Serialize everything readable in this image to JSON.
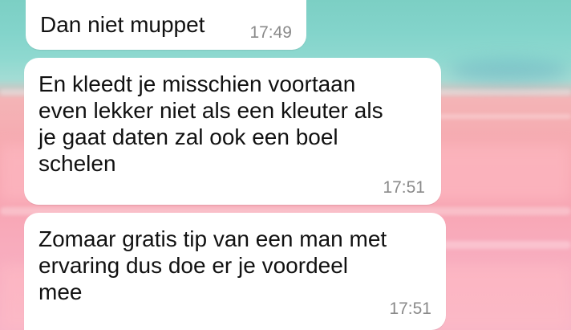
{
  "conversation": {
    "messages": [
      {
        "text": "Dan niet muppet",
        "time": "17:49"
      },
      {
        "text": "En kleedt je misschien voortaan\neven lekker niet als een kleuter als\nje gaat daten zal ook een boel\nschelen",
        "time": "17:51"
      },
      {
        "text": "Zomaar gratis tip van een man met\nervaring dus doe er je voordeel\nmee",
        "time": "17:51"
      }
    ]
  },
  "colors": {
    "bubble_background": "#ffffff",
    "text": "#111111",
    "timestamp": "#8a8a8a",
    "wallpaper_top": "#7ccfc4",
    "wallpaper_bottom": "#f7b4c8"
  }
}
